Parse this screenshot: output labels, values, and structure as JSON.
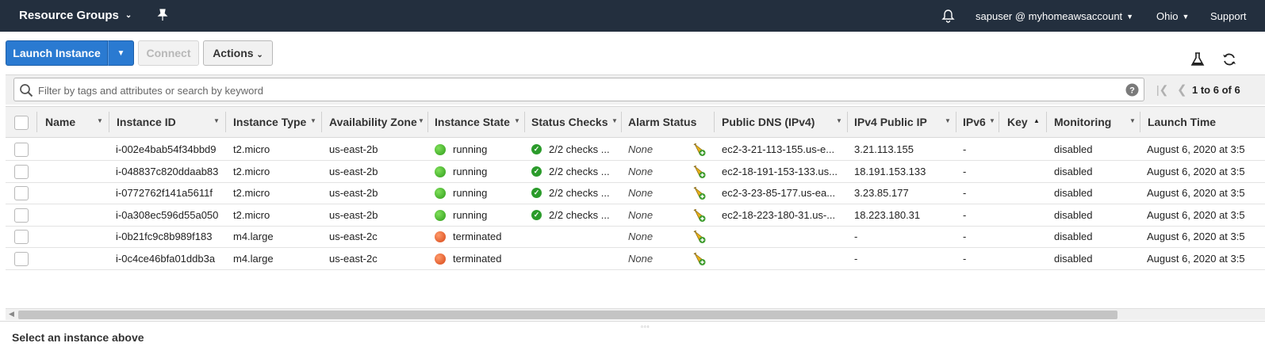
{
  "topnav": {
    "resource_groups": "Resource Groups",
    "user": "sapuser @ myhomeawsaccount",
    "region": "Ohio",
    "support": "Support"
  },
  "toolbar": {
    "launch_label": "Launch Instance",
    "connect_label": "Connect",
    "actions_label": "Actions"
  },
  "filter": {
    "placeholder": "Filter by tags and attributes or search by keyword",
    "pager_text": "1 to 6 of 6"
  },
  "columns": [
    "Name",
    "Instance ID",
    "Instance Type",
    "Availability Zone",
    "Instance State",
    "Status Checks",
    "Alarm Status",
    "Public DNS (IPv4)",
    "IPv4 Public IP",
    "IPv6",
    "Key",
    "Monitoring",
    "Launch Time"
  ],
  "rows": [
    {
      "name": "",
      "id": "i-002e4bab54f34bbd9",
      "type": "t2.micro",
      "az": "us-east-2b",
      "state": "running",
      "checks": "2/2 checks ...",
      "alarm": "None",
      "dns": "ec2-3-21-113-155.us-e...",
      "ip": "3.21.113.155",
      "ipv6": "-",
      "monitoring": "disabled",
      "launch": "August 6, 2020 at 3:5"
    },
    {
      "name": "",
      "id": "i-048837c820ddaab83",
      "type": "t2.micro",
      "az": "us-east-2b",
      "state": "running",
      "checks": "2/2 checks ...",
      "alarm": "None",
      "dns": "ec2-18-191-153-133.us...",
      "ip": "18.191.153.133",
      "ipv6": "-",
      "monitoring": "disabled",
      "launch": "August 6, 2020 at 3:5"
    },
    {
      "name": "",
      "id": "i-0772762f141a5611f",
      "type": "t2.micro",
      "az": "us-east-2b",
      "state": "running",
      "checks": "2/2 checks ...",
      "alarm": "None",
      "dns": "ec2-3-23-85-177.us-ea...",
      "ip": "3.23.85.177",
      "ipv6": "-",
      "monitoring": "disabled",
      "launch": "August 6, 2020 at 3:5"
    },
    {
      "name": "",
      "id": "i-0a308ec596d55a050",
      "type": "t2.micro",
      "az": "us-east-2b",
      "state": "running",
      "checks": "2/2 checks ...",
      "alarm": "None",
      "dns": "ec2-18-223-180-31.us-...",
      "ip": "18.223.180.31",
      "ipv6": "-",
      "monitoring": "disabled",
      "launch": "August 6, 2020 at 3:5"
    },
    {
      "name": "",
      "id": "i-0b21fc9c8b989f183",
      "type": "m4.large",
      "az": "us-east-2c",
      "state": "terminated",
      "checks": "",
      "alarm": "None",
      "dns": "",
      "ip": "-",
      "ipv6": "-",
      "monitoring": "disabled",
      "launch": "August 6, 2020 at 3:5"
    },
    {
      "name": "",
      "id": "i-0c4ce46bfa01ddb3a",
      "type": "m4.large",
      "az": "us-east-2c",
      "state": "terminated",
      "checks": "",
      "alarm": "None",
      "dns": "",
      "ip": "-",
      "ipv6": "-",
      "monitoring": "disabled",
      "launch": "August 6, 2020 at 3:5"
    }
  ],
  "bottom": {
    "select_message": "Select an instance above"
  },
  "colors": {
    "nav_bg": "#232f3e",
    "primary": "#2a7ad1",
    "running": "#2f9b1a",
    "terminated": "#d64617"
  }
}
